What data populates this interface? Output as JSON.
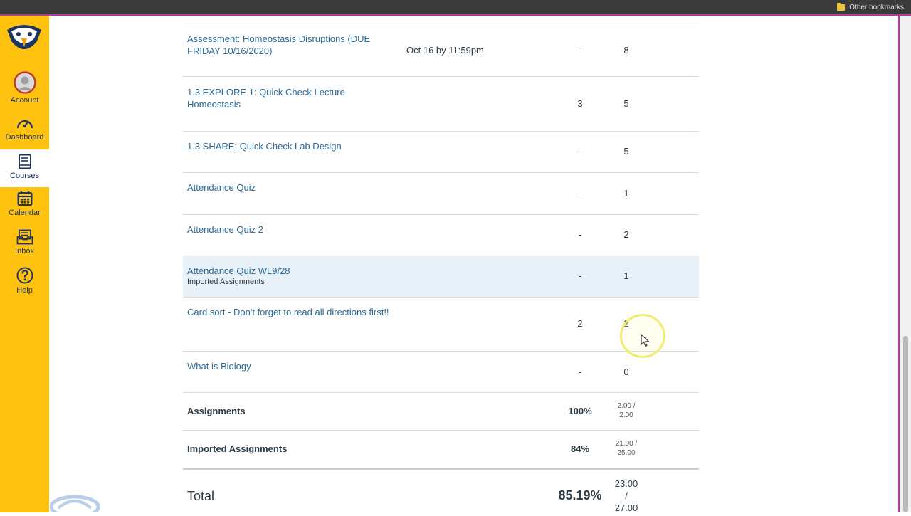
{
  "browser": {
    "bookmarks_label": "Other bookmarks"
  },
  "global_nav": {
    "items": [
      {
        "label": "Account",
        "icon": "account-avatar-icon"
      },
      {
        "label": "Dashboard",
        "icon": "dashboard-icon"
      },
      {
        "label": "Courses",
        "icon": "courses-icon",
        "active": true
      },
      {
        "label": "Calendar",
        "icon": "calendar-icon"
      },
      {
        "label": "Inbox",
        "icon": "inbox-icon"
      },
      {
        "label": "Help",
        "icon": "help-icon"
      }
    ]
  },
  "assignments": [
    {
      "title": "Assessment: Homeostasis Disruptions (DUE FRIDAY 10/16/2020)",
      "due": "Oct 16 by 11:59pm",
      "score": "-",
      "out_of": "8"
    },
    {
      "title": "1.3 EXPLORE 1: Quick Check Lecture Homeostasis",
      "due": "",
      "score": "3",
      "out_of": "5"
    },
    {
      "title": "1.3 SHARE: Quick Check Lab Design",
      "due": "",
      "score": "-",
      "out_of": "5"
    },
    {
      "title": "Attendance Quiz",
      "due": "",
      "score": "-",
      "out_of": "1"
    },
    {
      "title": "Attendance Quiz 2",
      "due": "",
      "score": "-",
      "out_of": "2"
    },
    {
      "title": "Attendance Quiz WL9/28",
      "subtitle": "Imported Assignments",
      "due": "",
      "score": "-",
      "out_of": "1",
      "highlighted": true
    },
    {
      "title": "Card sort - Don't forget to read all directions first!!",
      "due": "",
      "score": "2",
      "out_of": "2"
    },
    {
      "title": "What is Biology",
      "due": "",
      "score": "-",
      "out_of": "0"
    }
  ],
  "groups": [
    {
      "name": "Assignments",
      "percent": "100%",
      "fraction_line1": "2.00 /",
      "fraction_line2": "2.00"
    },
    {
      "name": "Imported Assignments",
      "percent": "84%",
      "fraction_line1": "21.00 /",
      "fraction_line2": "25.00"
    }
  ],
  "total": {
    "label": "Total",
    "percent": "85.19%",
    "fraction_line1": "23.00",
    "fraction_line2": "/",
    "fraction_line3": "27.00"
  },
  "colors": {
    "nav_bg": "#ffc20e",
    "link": "#2b6a96",
    "highlight_row": "#e8f1f8",
    "frame": "#b03a9a"
  }
}
